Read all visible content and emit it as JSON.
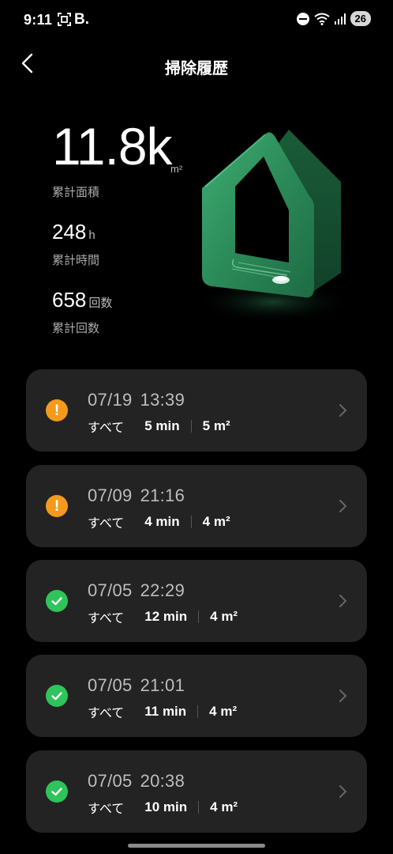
{
  "status_bar": {
    "time": "9:11",
    "indicator_b": "B.",
    "battery": "26"
  },
  "header": {
    "title": "掃除履歴",
    "back_icon": "chevron-left-icon"
  },
  "stats": {
    "area_value": "11.8k",
    "area_unit": "m²",
    "area_label": "累計面積",
    "time_value": "248",
    "time_unit": "h",
    "time_label": "累計時間",
    "count_value": "658",
    "count_unit": "回数",
    "count_label": "累計回数"
  },
  "records": [
    {
      "date": "07/19",
      "time": "13:39",
      "mode": "すべて",
      "duration": "5 min",
      "area": "5",
      "area_unit": "m²",
      "status": "warning",
      "status_color": "#f39a1c"
    },
    {
      "date": "07/09",
      "time": "21:16",
      "mode": "すべて",
      "duration": "4 min",
      "area": "4",
      "area_unit": "m²",
      "status": "warning",
      "status_color": "#f39a1c"
    },
    {
      "date": "07/05",
      "time": "22:29",
      "mode": "すべて",
      "duration": "12 min",
      "area": "4",
      "area_unit": "m²",
      "status": "success",
      "status_color": "#2fc45a"
    },
    {
      "date": "07/05",
      "time": "21:01",
      "mode": "すべて",
      "duration": "11 min",
      "area": "4",
      "area_unit": "m²",
      "status": "success",
      "status_color": "#2fc45a"
    },
    {
      "date": "07/05",
      "time": "20:38",
      "mode": "すべて",
      "duration": "10 min",
      "area": "4",
      "area_unit": "m²",
      "status": "success",
      "status_color": "#2fc45a"
    }
  ],
  "colors": {
    "background": "#000000",
    "card": "#232323",
    "accent_green": "#2e8a5a"
  }
}
